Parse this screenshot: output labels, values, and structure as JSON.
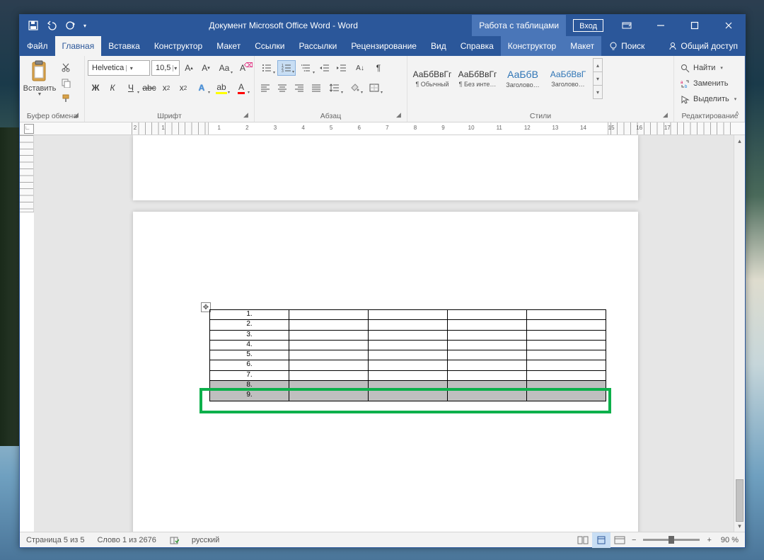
{
  "titlebar": {
    "doc_title": "Документ Microsoft Office Word  -  Word",
    "context_label": "Работа с таблицами",
    "signin": "Вход"
  },
  "tabs": {
    "file": "Файл",
    "home": "Главная",
    "insert": "Вставка",
    "design": "Конструктор",
    "layout": "Макет",
    "references": "Ссылки",
    "mailings": "Рассылки",
    "review": "Рецензирование",
    "view": "Вид",
    "help": "Справка",
    "table_design": "Конструктор",
    "table_layout": "Макет",
    "tell_me": "Поиск",
    "share": "Общий доступ"
  },
  "ribbon": {
    "clipboard": {
      "paste": "Вставить",
      "group": "Буфер обмена"
    },
    "font": {
      "name": "Helvetica",
      "size": "10,5",
      "group": "Шрифт"
    },
    "paragraph": {
      "group": "Абзац"
    },
    "styles": {
      "group": "Стили",
      "preview_text": "АаБбВвГг",
      "preview_heading": "АаБбВ",
      "preview_heading2": "АаБбВвГ",
      "normal": "¶ Обычный",
      "no_spacing": "¶ Без инте…",
      "heading1": "Заголово…",
      "heading2": "Заголово…"
    },
    "editing": {
      "group": "Редактирование",
      "find": "Найти",
      "replace": "Заменить",
      "select": "Выделить"
    }
  },
  "ruler": {
    "numbers": [
      "2",
      "1",
      "",
      "1",
      "2",
      "3",
      "4",
      "5",
      "6",
      "7",
      "8",
      "9",
      "10",
      "11",
      "12",
      "13",
      "14",
      "15",
      "16",
      "17",
      "",
      ""
    ]
  },
  "table": {
    "rows": [
      "1.",
      "2.",
      "3.",
      "4.",
      "5.",
      "6.",
      "7.",
      "8.",
      "9."
    ],
    "cols": 5,
    "selected_rows": [
      7,
      8
    ]
  },
  "statusbar": {
    "page": "Страница 5 из 5",
    "words": "Слово 1 из 2676",
    "lang": "русский",
    "zoom": "90 %"
  }
}
